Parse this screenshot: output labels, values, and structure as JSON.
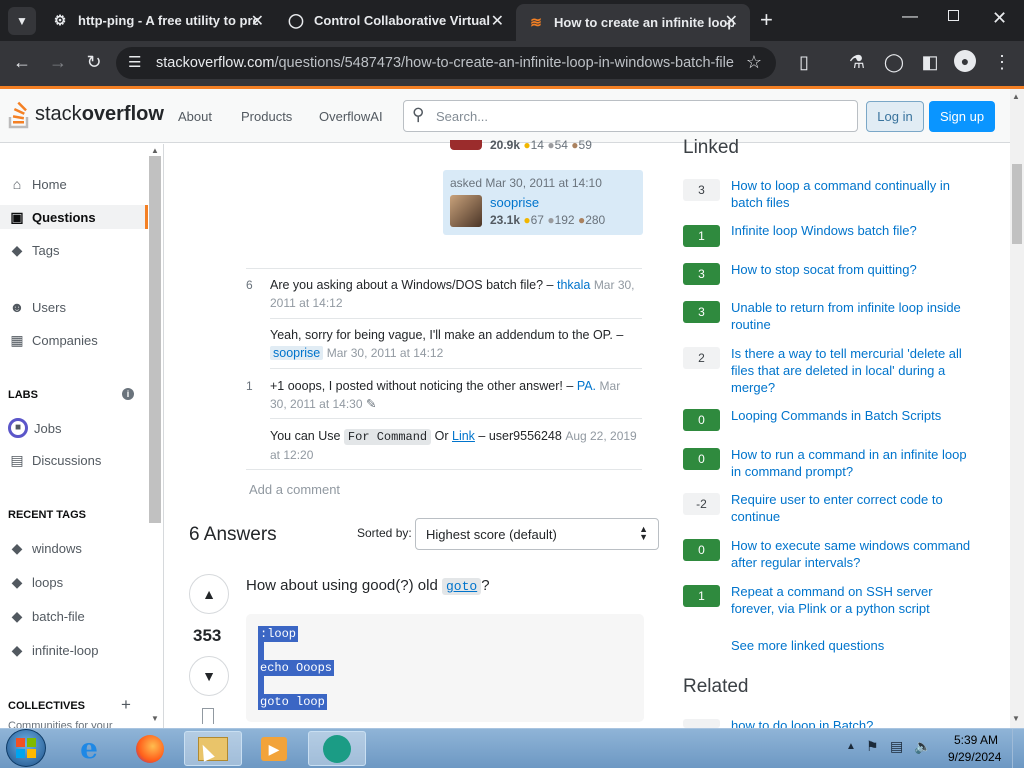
{
  "browser": {
    "tabs": [
      {
        "title": "http-ping - A free utility to pro",
        "icon": "gear-icon"
      },
      {
        "title": "Control Collaborative Virtual M",
        "icon": "globe-icon"
      },
      {
        "title": "How to create an infinite loop",
        "icon": "stackoverflow-icon"
      }
    ],
    "url_domain": "stackoverflow.com",
    "url_path": "/questions/5487473/how-to-create-an-infinite-loop-in-windows-batch-file"
  },
  "header": {
    "logo_stack": "stack",
    "logo_overflow": "overflow",
    "nav": [
      "About",
      "Products",
      "OverflowAI"
    ],
    "search_placeholder": "Search...",
    "login": "Log in",
    "signup": "Sign up"
  },
  "sidebar": {
    "items": [
      "Home",
      "Questions",
      "Tags",
      "Users",
      "Companies"
    ],
    "labs_heading": "LABS",
    "labs_items": [
      "Jobs",
      "Discussions"
    ],
    "recent_tags_heading": "RECENT TAGS",
    "recent_tags": [
      "windows",
      "loops",
      "batch-file",
      "infinite-loop"
    ],
    "collectives_heading": "COLLECTIVES",
    "collectives_sub": "Communities for your"
  },
  "question": {
    "editor_rep": "20.9k",
    "editor_badges": {
      "gold": "14",
      "silver": "54",
      "bronze": "59"
    },
    "asked_label": "asked Mar 30, 2011 at 14:10",
    "author": "sooprise",
    "author_rep": "23.1k",
    "author_badges": {
      "gold": "67",
      "silver": "192",
      "bronze": "280"
    }
  },
  "comments": [
    {
      "score": "6",
      "text": "Are you asking about a Windows/DOS batch file? –",
      "user": "thkala",
      "date": "Mar 30, 2011 at 14:12"
    },
    {
      "score": "",
      "text": "Yeah, sorry for being vague, I'll make an addendum to the OP. –",
      "user": "sooprise",
      "date": "Mar 30, 2011 at 14:12"
    },
    {
      "score": "1",
      "text": "+1 ooops, I posted without noticing the other answer! –",
      "user": "PA.",
      "date": "Mar 30, 2011 at 14:30"
    },
    {
      "score": "",
      "text_pre": "You can Use",
      "code": "For Command",
      "text_mid": "Or",
      "link": "Link",
      "user_plain": "– user9556248",
      "date": "Aug 22, 2019 at 12:20"
    }
  ],
  "add_comment": "Add a comment",
  "answers": {
    "count_label": "6 Answers",
    "sorted_by_label": "Sorted by:",
    "sort_value": "Highest score (default)",
    "top_score": "353",
    "top_text_pre": "How about using good(?) old",
    "top_code": "goto",
    "top_text_post": "?",
    "code_lines": [
      ":loop",
      "echo Ooops",
      "goto loop"
    ]
  },
  "linked": {
    "heading": "Linked",
    "items": [
      {
        "score": "3",
        "style": "n",
        "title": "How to loop a command continually in batch files"
      },
      {
        "score": "1",
        "style": "g",
        "title": "Infinite loop Windows batch file?"
      },
      {
        "score": "3",
        "style": "g",
        "title": "How to stop socat from quitting?"
      },
      {
        "score": "3",
        "style": "g",
        "title": "Unable to return from infinite loop inside routine"
      },
      {
        "score": "2",
        "style": "n",
        "title": "Is there a way to tell mercurial 'delete all files that are deleted in local' during a merge?"
      },
      {
        "score": "0",
        "style": "g",
        "title": "Looping Commands in Batch Scripts"
      },
      {
        "score": "0",
        "style": "g",
        "title": "How to run a command in an infinite loop in command prompt?"
      },
      {
        "score": "-2",
        "style": "n",
        "title": "Require user to enter correct code to continue"
      },
      {
        "score": "0",
        "style": "g",
        "title": "How to execute same windows command after regular intervals?"
      },
      {
        "score": "1",
        "style": "g",
        "title": "Repeat a command on SSH server forever, via Plink or a python script"
      }
    ],
    "see_more": "See more linked questions",
    "related_heading": "Related",
    "related_first": "how to do loop in Batch?"
  },
  "taskbar": {
    "time": "5:39 AM",
    "date": "9/29/2024",
    "apps": [
      "windows-start-icon",
      "internet-explorer-icon",
      "firefox-icon",
      "file-explorer-icon",
      "media-player-icon",
      "app-icon"
    ]
  }
}
